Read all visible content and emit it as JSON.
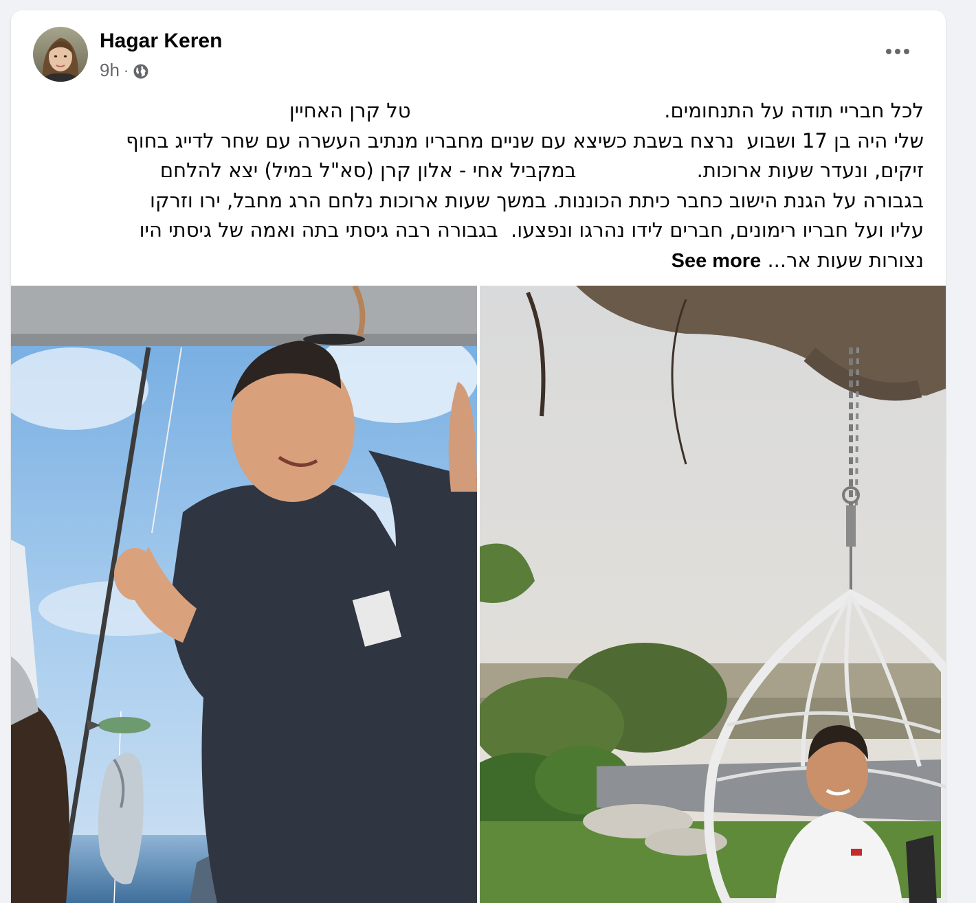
{
  "post": {
    "author": "Hagar Keren",
    "time": "9h",
    "separator": "·",
    "audience_icon": "globe-icon",
    "more_icon": "more-horizontal-icon",
    "text_lines": [
      "לכל חבריי תודה על התנחומים.                                        טל קרן האחיין",
      "שלי היה בן 17 ושבוע  נרצח בשבת כשיצא עם שניים מחבריו מנתיב העשרה עם שחר לדייג בחוף",
      "זיקים, ונעדר שעות ארוכות.                   במקביל אחי - אלון קרן (סא\"ל במיל) יצא להלחם",
      "בגבורה על הגנת הישוב כחבר כיתת הכוננות. במשך שעות ארוכות נלחם הרג מחבל, ירו וזרקו",
      "עליו ועל חבריו רימונים, חברים לידו נהרגו ונפצעו.  בגבורה רבה גיסתי בתה ואמה של גיסתי היו"
    ],
    "last_line_text": "נצורות שעות אר...",
    "see_more": "See more"
  },
  "colors": {
    "page_bg": "#f0f2f5",
    "card_bg": "#ffffff",
    "text_primary": "#050505",
    "text_secondary": "#65676b"
  }
}
